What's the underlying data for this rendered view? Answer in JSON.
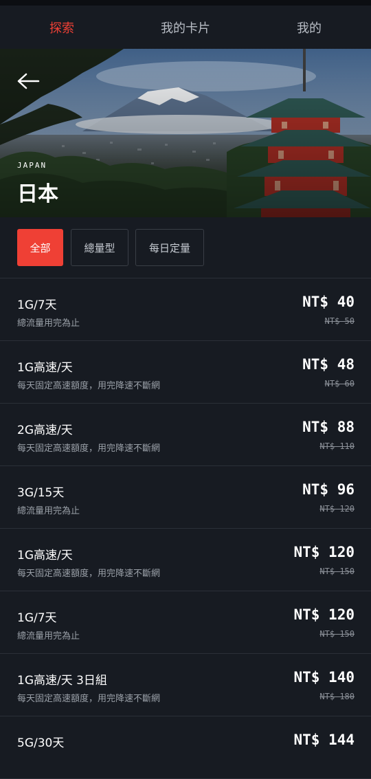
{
  "tabs": [
    {
      "label": "探索",
      "active": true
    },
    {
      "label": "我的卡片",
      "active": false
    },
    {
      "label": "我的",
      "active": false
    }
  ],
  "hero": {
    "country_en": "JAPAN",
    "country": "日本",
    "back_icon": "arrow-left-icon"
  },
  "filters": [
    {
      "label": "全部",
      "active": true
    },
    {
      "label": "總量型",
      "active": false
    },
    {
      "label": "每日定量",
      "active": false
    }
  ],
  "plans": [
    {
      "name": "1G/7天",
      "desc": "總流量用完為止",
      "price": "NT$ 40",
      "original": "NT$ 50"
    },
    {
      "name": "1G高速/天",
      "desc": "每天固定高速額度，用完降速不斷網",
      "price": "NT$ 48",
      "original": "NT$ 60"
    },
    {
      "name": "2G高速/天",
      "desc": "每天固定高速額度，用完降速不斷網",
      "price": "NT$ 88",
      "original": "NT$ 110"
    },
    {
      "name": "3G/15天",
      "desc": "總流量用完為止",
      "price": "NT$ 96",
      "original": "NT$ 120"
    },
    {
      "name": "1G高速/天",
      "desc": "每天固定高速額度，用完降速不斷網",
      "price": "NT$ 120",
      "original": "NT$ 150"
    },
    {
      "name": "1G/7天",
      "desc": "總流量用完為止",
      "price": "NT$ 120",
      "original": "NT$ 150"
    },
    {
      "name": "1G高速/天 3日組",
      "desc": "每天固定高速額度，用完降速不斷網",
      "price": "NT$ 140",
      "original": "NT$ 180"
    },
    {
      "name": "5G/30天",
      "desc": "",
      "price": "NT$ 144",
      "original": ""
    }
  ],
  "colors": {
    "accent": "#ef4035",
    "background": "#171b22",
    "divider": "#2b3038"
  }
}
